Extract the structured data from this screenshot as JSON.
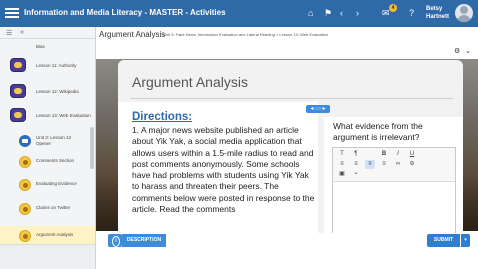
{
  "app": {
    "title": "Information and Media Literacy - MASTER - Activities"
  },
  "topbar": {
    "icons": [
      "home-icon",
      "flag-icon",
      "chevron-left-icon",
      "chevron-right-icon",
      "notifications-icon",
      "help-icon"
    ],
    "notifications_count": "4",
    "user_first_name": "Betsy",
    "user_last_name": "Hartnett"
  },
  "sidebar": {
    "items": [
      {
        "label": "Bias"
      },
      {
        "label": "Lesson 11: Authority"
      },
      {
        "label": "Lesson 12: Wikipedia"
      },
      {
        "label": "Lesson 13: Web Evaluation"
      },
      {
        "label": "Unit 3: Lesson 13 Opener"
      },
      {
        "label": "Comments Section"
      },
      {
        "label": "Evaluating Evidence"
      },
      {
        "label": "Claims on Twitter"
      },
      {
        "label": "Argument Analysis"
      }
    ]
  },
  "main": {
    "page_title": "Argument Analysis",
    "breadcrumb": "Unit 3: Fake News, Information Evaluation and Lateral Reading > Lesson 13: Web Evaluation",
    "card_title": "Argument Analysis",
    "directions_heading": "Directions:",
    "directions_text": "1. A major news website published an article about Yik Yak, a social media application that allows users within a 1.5-mile radius to read and post comments anonymously. Some schools have had problems with students using Yik Yak to harass and threaten their peers. The comments below were posted in response to the article. Read the comments",
    "question": "What evidence from the argument is irrelevant?"
  },
  "editor_toolbar": {
    "row1": [
      "T",
      "¶",
      "B",
      "I",
      "U"
    ],
    "row2": [
      "≡",
      "≡",
      "≡",
      "≡",
      "∞",
      "⊘"
    ],
    "row3": [
      "▣",
      "⌁"
    ]
  },
  "bottombar": {
    "description_label": "DESCRIPTION",
    "submit_label": "SUBMIT"
  }
}
